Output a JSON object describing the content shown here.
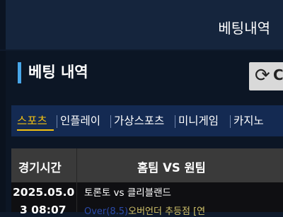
{
  "header": {
    "title": "베팅내역"
  },
  "section": {
    "title": "베팅 내역"
  },
  "refresh": {
    "icon": "refresh-icon",
    "label": "C"
  },
  "tabs": [
    {
      "label": "스포츠",
      "active": true
    },
    {
      "label": "인플레이",
      "active": false
    },
    {
      "label": "가상스포츠",
      "active": false
    },
    {
      "label": "미니게임",
      "active": false
    },
    {
      "label": "카지노",
      "active": false
    }
  ],
  "table": {
    "columns": [
      "경기시간",
      "홈팀 VS 원팀"
    ],
    "rows": [
      {
        "time_line1": "2025.05.0",
        "time_line2": "3 08:07",
        "match": "토론토 vs 클리블랜드",
        "bet_pick": "Over",
        "bet_odds": "(8.5)",
        "bet_market": "오버언더 추등점 [연"
      }
    ]
  },
  "colors": {
    "accent_blue": "#48a6e8",
    "tab_active": "#f5c211",
    "tab_bar": "#142a52",
    "header_bg": "#15253d"
  }
}
